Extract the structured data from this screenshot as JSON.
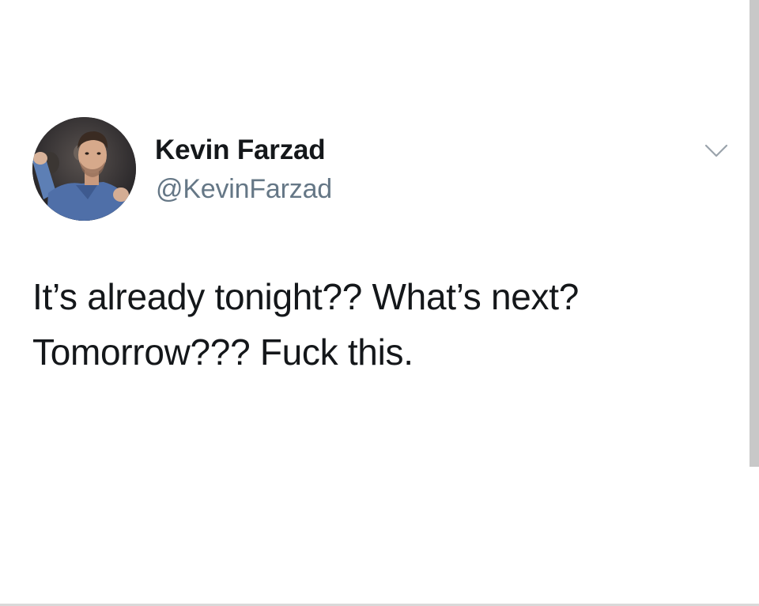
{
  "tweet": {
    "author": {
      "display_name": "Kevin Farzad",
      "handle": "@KevinFarzad",
      "avatar_icon": "profile-photo"
    },
    "menu_icon": "chevron-down-icon",
    "text_lines": [
      "It’s already tonight?? What’s next?",
      "Tomorrow??? Fuck this."
    ]
  },
  "colors": {
    "text_primary": "#14171a",
    "text_secondary": "#657786",
    "scrollbar": "#c8c8c8"
  }
}
